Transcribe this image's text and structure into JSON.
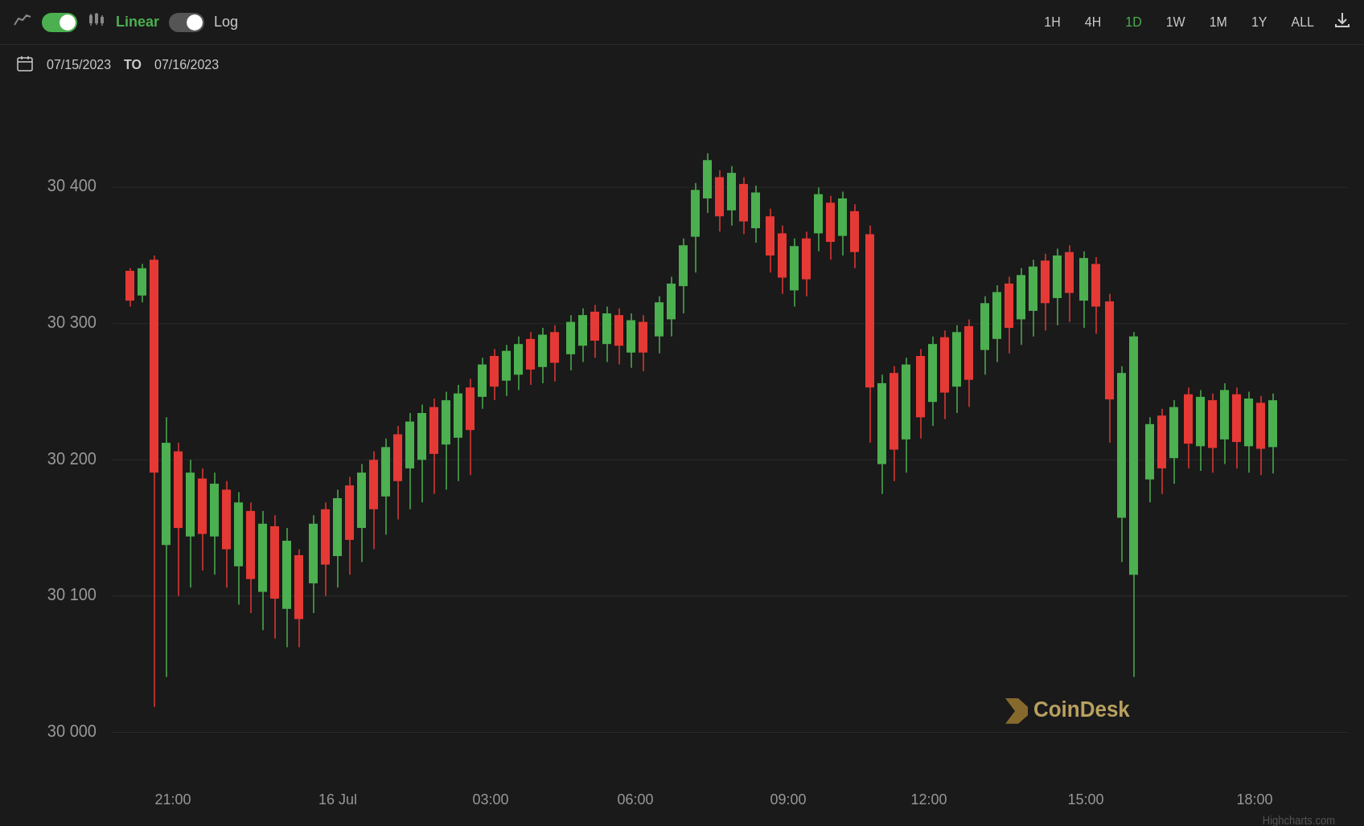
{
  "toolbar": {
    "chart_type_icon": "📈",
    "linear_label": "Linear",
    "log_label": "Log",
    "timeframes": [
      {
        "label": "1H",
        "active": false
      },
      {
        "label": "4H",
        "active": false
      },
      {
        "label": "1D",
        "active": true
      },
      {
        "label": "1W",
        "active": false
      },
      {
        "label": "1M",
        "active": false
      },
      {
        "label": "1Y",
        "active": false
      },
      {
        "label": "ALL",
        "active": false
      }
    ],
    "download_icon": "⬇"
  },
  "date_range": {
    "from": "07/15/2023",
    "to_label": "TO",
    "to": "07/16/2023"
  },
  "chart": {
    "y_labels": [
      "30 400",
      "30 300",
      "30 200",
      "30 100",
      "30 000"
    ],
    "x_labels": [
      "21:00",
      "16 Jul",
      "03:00",
      "06:00",
      "09:00",
      "12:00",
      "15:00",
      "18:00"
    ],
    "colors": {
      "bull": "#4CAF50",
      "bear": "#e53935",
      "grid": "#2a2a2a",
      "background": "#1a1a1a"
    }
  },
  "watermark": {
    "text": "CoinDesk",
    "credit": "Highcharts.com"
  }
}
